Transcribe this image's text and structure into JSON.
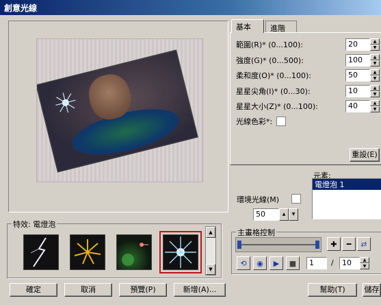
{
  "window": {
    "title": "創意光線"
  },
  "tabs": [
    {
      "label": "基本"
    },
    {
      "label": "進階"
    }
  ],
  "basic": {
    "rows": [
      {
        "label": "範圍(R)* (0...100):",
        "value": "20"
      },
      {
        "label": "強度(G)* (0...500):",
        "value": "100"
      },
      {
        "label": "柔和度(O)* (0...100):",
        "value": "50"
      },
      {
        "label": "星星尖角(I)* (0...30):",
        "value": "10"
      },
      {
        "label": "星星大小(Z)* (0...100):",
        "value": "40"
      }
    ],
    "color_label": "光線色彩*:",
    "reset_label": "重設(E)"
  },
  "effects": {
    "title": "特效: 電燈泡"
  },
  "elements": {
    "title": "元素:",
    "items": [
      "電燈泡 1"
    ]
  },
  "ambient": {
    "label": "環境光線(M)",
    "value": "50"
  },
  "keyframe": {
    "title": "主畫格控制",
    "current": "1",
    "separator": "/",
    "total": "10"
  },
  "footer": {
    "ok": "確定",
    "cancel": "取消",
    "preview": "預覽(P)",
    "add": "新增(A)...",
    "help": "幫助(T)",
    "save": "儲存"
  }
}
